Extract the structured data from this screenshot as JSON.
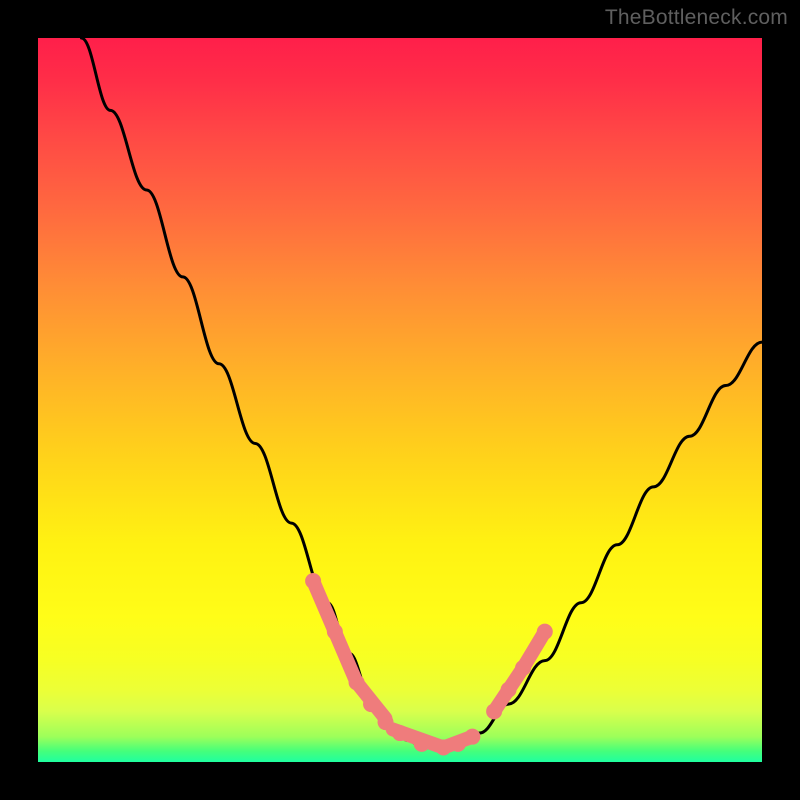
{
  "watermark": "TheBottleneck.com",
  "chart_data": {
    "type": "line",
    "title": "",
    "xlabel": "",
    "ylabel": "",
    "xlim": [
      0,
      100
    ],
    "ylim": [
      0,
      100
    ],
    "grid": false,
    "legend": false,
    "series": [
      {
        "name": "bottleneck-curve",
        "x": [
          6,
          10,
          15,
          20,
          25,
          30,
          35,
          40,
          43,
          46,
          49,
          51,
          53,
          55,
          58,
          61,
          65,
          70,
          75,
          80,
          85,
          90,
          95,
          100
        ],
        "y": [
          100,
          90,
          79,
          67,
          55,
          44,
          33,
          22,
          15,
          9,
          5,
          3,
          2.2,
          2,
          2.4,
          4,
          8,
          14,
          22,
          30,
          38,
          45,
          52,
          58
        ]
      }
    ],
    "markers": {
      "name": "highlighted-points",
      "color": "#ef7c7c",
      "segments": [
        {
          "x": [
            38,
            44
          ],
          "y": [
            25,
            11
          ]
        },
        {
          "x": [
            44,
            48
          ],
          "y": [
            11,
            6
          ]
        },
        {
          "x": [
            49,
            56
          ],
          "y": [
            4.5,
            2
          ]
        },
        {
          "x": [
            56,
            60
          ],
          "y": [
            2,
            3.5
          ]
        },
        {
          "x": [
            63,
            67
          ],
          "y": [
            7,
            13
          ]
        },
        {
          "x": [
            67,
            70
          ],
          "y": [
            13,
            18
          ]
        }
      ],
      "dots": [
        {
          "x": 38,
          "y": 25
        },
        {
          "x": 41,
          "y": 18
        },
        {
          "x": 44,
          "y": 11
        },
        {
          "x": 46,
          "y": 8
        },
        {
          "x": 48,
          "y": 5.5
        },
        {
          "x": 50,
          "y": 4
        },
        {
          "x": 53,
          "y": 2.5
        },
        {
          "x": 56,
          "y": 2
        },
        {
          "x": 58,
          "y": 2.5
        },
        {
          "x": 60,
          "y": 3.5
        },
        {
          "x": 63,
          "y": 7
        },
        {
          "x": 65,
          "y": 10
        },
        {
          "x": 67,
          "y": 13
        },
        {
          "x": 70,
          "y": 18
        }
      ]
    }
  }
}
